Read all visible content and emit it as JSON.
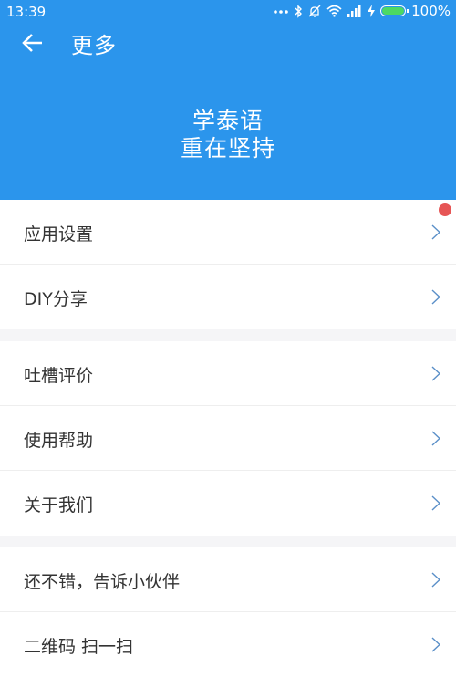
{
  "status_bar": {
    "time": "13:39",
    "battery_percent_label": "100%",
    "battery_level": 1.0,
    "icons": [
      "dots-icon",
      "bluetooth-icon",
      "mute-icon",
      "wifi-icon",
      "signal-icon",
      "charging-icon",
      "battery-icon"
    ]
  },
  "header": {
    "title": "更多",
    "slogan_line1": "学泰语",
    "slogan_line2": "重在坚持",
    "background_color": "#2b95ec"
  },
  "menu": {
    "groups": [
      {
        "items": [
          {
            "label": "应用设置",
            "badge": true
          },
          {
            "label": "DIY分享"
          }
        ]
      },
      {
        "items": [
          {
            "label": "吐槽评价"
          },
          {
            "label": "使用帮助"
          },
          {
            "label": "关于我们"
          }
        ]
      },
      {
        "items": [
          {
            "label": "还不错，告诉小伙伴"
          },
          {
            "label": "二维码 扫一扫"
          }
        ]
      }
    ],
    "badge_color": "#e65555",
    "chevron_color": "#5a8fc8"
  }
}
